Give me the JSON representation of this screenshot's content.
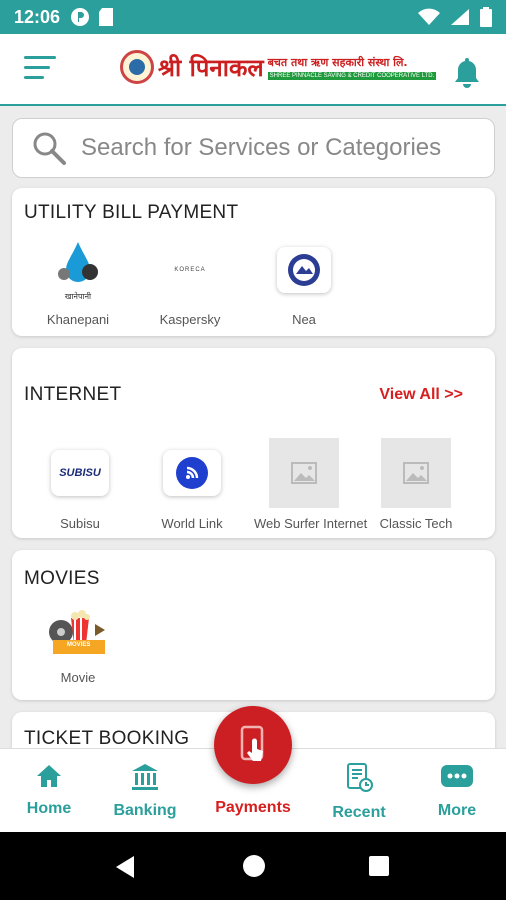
{
  "status_bar": {
    "time": "12:06",
    "icons_left": [
      "p-icon",
      "sd-card-icon"
    ],
    "icons_right": [
      "wifi-icon",
      "signal-icon",
      "battery-icon"
    ]
  },
  "app_bar": {
    "logo_name": "श्री पिनाकल",
    "logo_line1": "बचत तथा ऋण सहकारी संस्था लि.",
    "logo_line2": "SHREE PINNACLE SAVING & CREDIT COOPERATIVE LTD.",
    "accent": "#2b9f9b"
  },
  "search": {
    "placeholder": "Search for Services or Categories"
  },
  "sections": {
    "utility": {
      "title": "UTILITY BILL PAYMENT",
      "items": [
        {
          "label": "Khanepani",
          "logo_text": "खानेपानी"
        },
        {
          "label": "Kaspersky",
          "logo_text": "KORECA"
        },
        {
          "label": "Nea"
        }
      ]
    },
    "internet": {
      "title": "INTERNET",
      "view_all": "View All >>",
      "items": [
        {
          "label": "Subisu",
          "logo_text": "SUBISU"
        },
        {
          "label": "World Link"
        },
        {
          "label": "Web Surfer  Internet"
        },
        {
          "label": "Classic Tech"
        }
      ]
    },
    "movies": {
      "title": "MOVIES",
      "items": [
        {
          "label": "Movie",
          "logo_text": "MOVIES"
        }
      ]
    },
    "ticket": {
      "title": "TICKET BOOKING"
    }
  },
  "bottom_nav": {
    "home": "Home",
    "banking": "Banking",
    "payments": "Payments",
    "recent": "Recent",
    "more": "More",
    "active": "payments",
    "active_color": "#d62020"
  }
}
